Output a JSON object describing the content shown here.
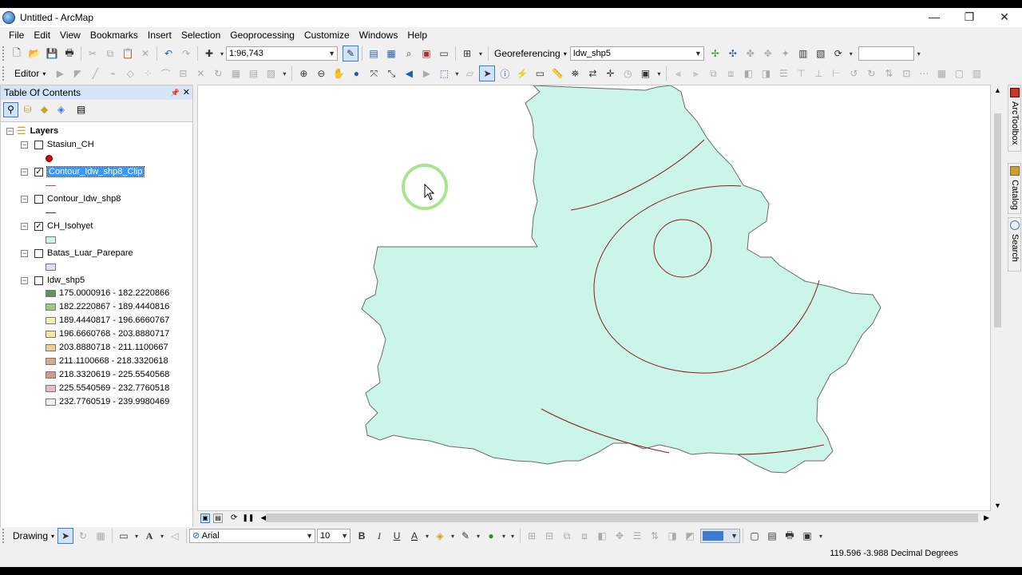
{
  "window": {
    "title": "Untitled - ArcMap",
    "controls": [
      "—",
      "❐",
      "✕"
    ]
  },
  "menu": [
    "File",
    "Edit",
    "View",
    "Bookmarks",
    "Insert",
    "Selection",
    "Geoprocessing",
    "Customize",
    "Windows",
    "Help"
  ],
  "toolbar": {
    "scale_value": "1:96,743",
    "georef_label": "Georeferencing",
    "layer_combo_value": "Idw_shp5",
    "editor_label": "Editor"
  },
  "toc": {
    "title": "Table Of Contents",
    "pin": "📌",
    "close": "✕",
    "root_label": "Layers",
    "layers": [
      {
        "name": "Stasiun_CH",
        "checked": false,
        "symbol": "point",
        "color": "#e00000"
      },
      {
        "name": "Contour_Idw_shp8_Clip",
        "checked": true,
        "symbol": "line",
        "color": "#c0504d",
        "selected": true
      },
      {
        "name": "Contour_Idw_shp8",
        "checked": false,
        "symbol": "line",
        "color": "#2c2ca0"
      },
      {
        "name": "CH_Isohyet",
        "checked": true,
        "symbol": "fill",
        "color": "#ccf5ea"
      },
      {
        "name": "Batas_Luar_Parepare",
        "checked": false,
        "symbol": "fill",
        "color": "#dcdcf8"
      },
      {
        "name": "Idw_shp5",
        "checked": false,
        "symbol": "classes"
      }
    ],
    "classes": [
      {
        "label": "175.0000916 - 182.2220866",
        "color": "#6b8e5a"
      },
      {
        "label": "182.2220867 - 189.4440816",
        "color": "#a3c585"
      },
      {
        "label": "189.4440817 - 196.6660767",
        "color": "#f5f0b0"
      },
      {
        "label": "196.6660768 - 203.8880717",
        "color": "#f5e6a0"
      },
      {
        "label": "203.8880718 - 211.1100667",
        "color": "#f3cd8f"
      },
      {
        "label": "211.1100668 - 218.3320618",
        "color": "#d9a98a"
      },
      {
        "label": "218.3320619 - 225.5540568",
        "color": "#cf9a90"
      },
      {
        "label": "225.5540569 - 232.7760518",
        "color": "#e6bccb"
      },
      {
        "label": "232.7760519 - 239.9980469",
        "color": "#f7ecef"
      }
    ]
  },
  "side_tabs": [
    "ArcToolbox",
    "Catalog",
    "Search"
  ],
  "drawing": {
    "label": "Drawing",
    "font_name": "Arial",
    "font_size": "10",
    "bold": "B",
    "italic": "I",
    "underline": "U"
  },
  "status": {
    "coords": "119.596  -3.988 Decimal Degrees"
  },
  "colors": {
    "polygon_fill": "#ccf5ea",
    "contour": "#8b1a1a",
    "cursor_ring": "#9be07a",
    "selection": "#3399ff"
  }
}
